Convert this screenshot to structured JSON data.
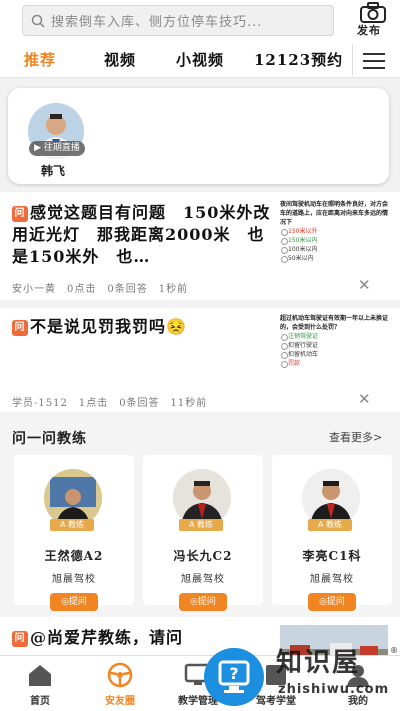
{
  "search": {
    "placeholder": "搜索倒车入库、侧方位停车技巧..."
  },
  "publish": {
    "label": "发布"
  },
  "tabs": [
    {
      "label": "推荐",
      "active": true
    },
    {
      "label": "视频",
      "active": false
    },
    {
      "label": "小视频",
      "active": false
    },
    {
      "label": "12123预约",
      "active": false
    }
  ],
  "live": {
    "tag": "往期直播",
    "name": "韩飞"
  },
  "posts": [
    {
      "badge": "问",
      "title": "感觉这题目有问题　150米外改用近光灯　那我距离2000米　也是150米外　也…",
      "meta": "安&#x5C0F;一黄　0点击　0条回答　1秒前",
      "thumb": {
        "head": "夜间驾驶机动车在照明条件良好，对方会车的道路上，应在距离对向来车多远的情况下",
        "options": [
          {
            "text": "150米以外",
            "state": "bad"
          },
          {
            "text": "150米以内",
            "state": "ok"
          },
          {
            "text": "100米以内",
            "state": ""
          },
          {
            "text": "50米以内",
            "state": ""
          }
        ]
      }
    },
    {
      "badge": "问",
      "title": "不是说见罚我罚吗😣",
      "meta": "学员-1512　1点击　0条回答　11秒前",
      "thumb": {
        "head": "超过机动车驾驶证有效期一年以上未换证的，会受到什么处罚？",
        "options": [
          {
            "text": "注销驾驶证",
            "state": "ok"
          },
          {
            "text": "扣留行驶证",
            "state": ""
          },
          {
            "text": "扣留机动车",
            "state": ""
          },
          {
            "text": "罚款",
            "state": "bad"
          }
        ]
      }
    }
  ],
  "coach_section": {
    "title": "问一问教练",
    "more": "查看更多>",
    "badge": "教练",
    "ask_label": "◎提问",
    "coaches": [
      {
        "name": "王然德A2",
        "school": "旭晨驾校"
      },
      {
        "name": "冯长九C2",
        "school": "旭晨驾校"
      },
      {
        "name": "李亮C1科",
        "school": "旭晨驾校"
      }
    ]
  },
  "last_post": {
    "badge": "问",
    "title": "@尚爱芹教练，请问"
  },
  "bottom_nav": [
    {
      "label": "首页",
      "icon": "home-icon",
      "active": false
    },
    {
      "label": "安友圈",
      "icon": "steering-wheel-icon",
      "active": true
    },
    {
      "label": "教学管理",
      "icon": "screen-icon",
      "active": false
    },
    {
      "label": "驾考学堂",
      "icon": "book-icon",
      "active": false
    },
    {
      "label": "我的",
      "icon": "user-icon",
      "active": false
    }
  ],
  "watermark": {
    "main": "知识屋",
    "sub": "zhishiwu.com",
    "reg": "®"
  },
  "colors": {
    "accent": "#f08522",
    "badge": "#f06b3a",
    "fab": "#1d8fe0"
  }
}
